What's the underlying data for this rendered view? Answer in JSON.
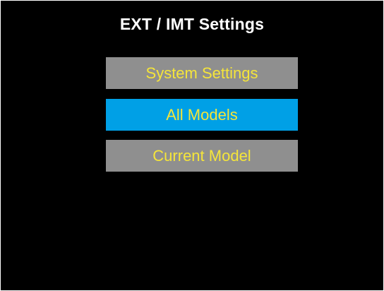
{
  "screen": {
    "title": "EXT / IMT Settings"
  },
  "menu": {
    "items": [
      {
        "label": "System Settings",
        "selected": false
      },
      {
        "label": "All Models",
        "selected": true
      },
      {
        "label": "Current Model",
        "selected": false
      }
    ]
  },
  "colors": {
    "background": "#000000",
    "title_text": "#ffffff",
    "item_text": "#f5e53a",
    "item_bg": "#8f8f8f",
    "selected_bg": "#00a0e6"
  }
}
